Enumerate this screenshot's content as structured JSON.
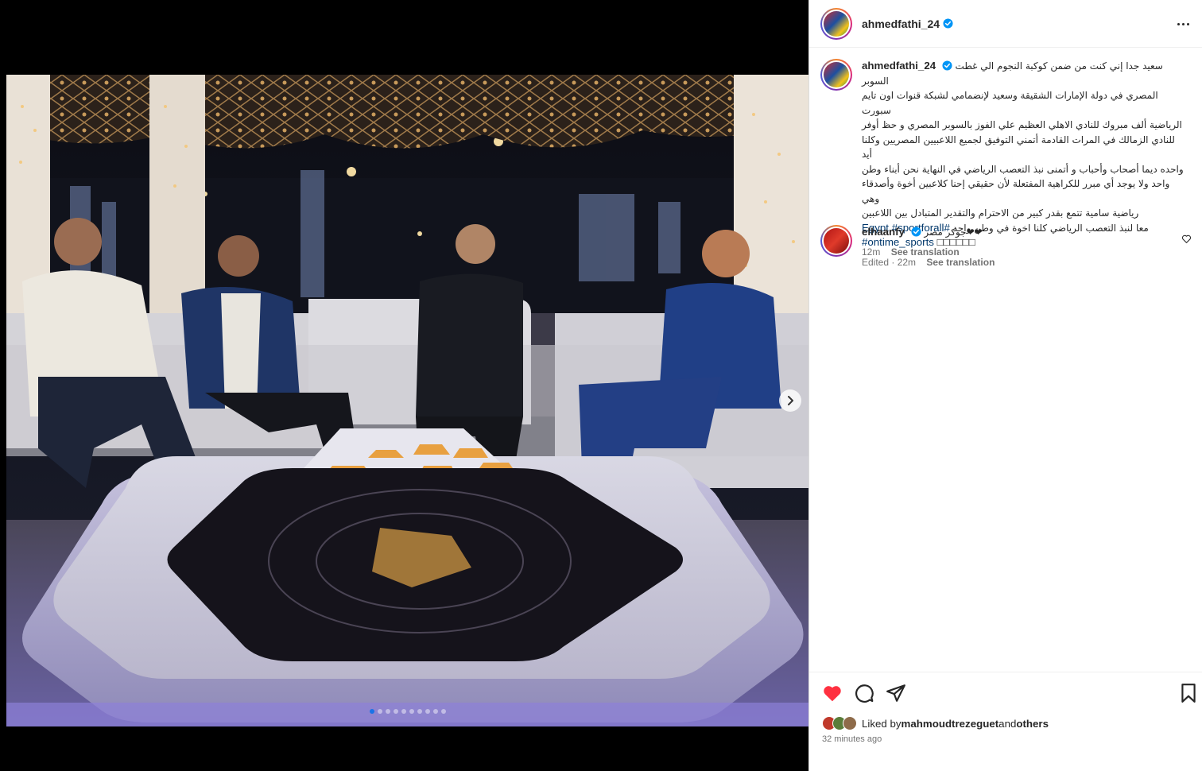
{
  "post": {
    "author": "ahmedfathi_24",
    "caption_lines": [
      "سعيد جدا إني كنت من ضمن كوكبة النجوم الي غطت السوبر",
      "المصري في دولة الإمارات الشقيقة وسعيد لإنضمامي لشبكة قنوات اون تايم سبورت",
      "الرياضية ألف مبروك للنادي الاهلي العظيم علي الفوز بالسوبر المصري و حظ أوفر",
      "للنادي الزمالك في المرات القادمة أتمني التوفيق لجميع اللاعبيين المصريين وكلنا أيد",
      "واحده ديما أصحاب وأحباب و أتمنى نبذ التعصب الرياضي في النهاية نحن أبناء وطن",
      "واحد ولا يوجد أي مبرر للكراهية المفتعلة لأن حقيقي إحنا كلاعبين أخوة وأصدقاء وهي",
      "رياضية سامية تتمع بقدر كبير من الاحترام والتقدير المتبادل بين اللاعبين",
      "معا لنبذ التعصب الرياضي كلنا اخوة في وطن واحد"
    ],
    "hashtag_line_1": "Egypt #sportforall#",
    "hashtag_line_2": "#ontime_sports ",
    "hashtag_boxes": "□□□□□□",
    "edited_time": "Edited · 22m",
    "see_translation": "See translation"
  },
  "comment": {
    "author": "elhaanfy",
    "text": "جوكر مصر❤❤",
    "time": "12m",
    "see_translation": "See translation"
  },
  "likes": {
    "prefix": "Liked by ",
    "user": "mahmoudtrezeguet",
    "and": " and ",
    "others": "others"
  },
  "time_ago": "32 minutes ago",
  "carousel": {
    "count": 10,
    "active_index": 0
  },
  "colors": {
    "accent": "#0095f6",
    "heart": "#ff3040",
    "link": "#00376b"
  },
  "icons": [
    "verified-icon",
    "more-icon",
    "heart-icon",
    "comment-icon",
    "share-icon",
    "bookmark-icon",
    "chevron-right-icon"
  ]
}
